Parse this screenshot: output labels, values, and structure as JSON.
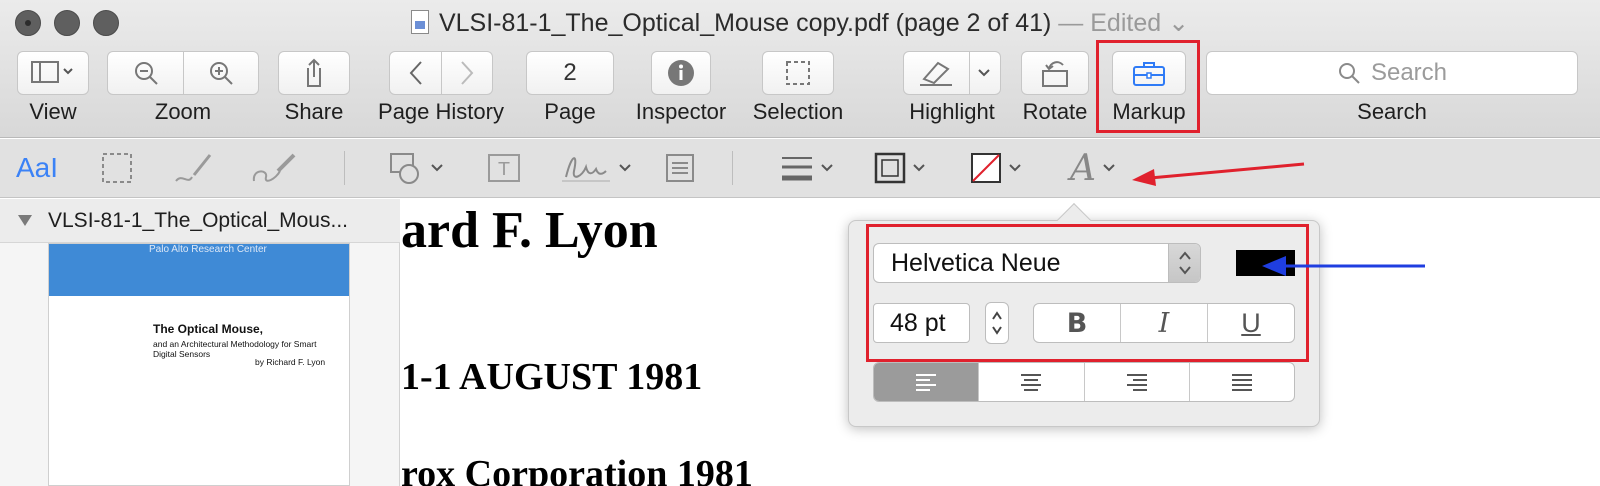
{
  "window": {
    "title": "VLSI-81-1_The_Optical_Mouse copy.pdf (page 2 of 41)",
    "edited": "— Edited"
  },
  "toolbar": {
    "view_label": "View",
    "zoom_label": "Zoom",
    "share_label": "Share",
    "page_history_label": "Page History",
    "page_value": "2",
    "page_label": "Page",
    "inspector_label": "Inspector",
    "selection_label": "Selection",
    "highlight_label": "Highlight",
    "rotate_label": "Rotate",
    "markup_label": "Markup",
    "search_placeholder": "Search",
    "search_label": "Search"
  },
  "markup_bar": {
    "text_tool": "AaI"
  },
  "sidebar": {
    "doc_name": "VLSI-81-1_The_Optical_Mous...",
    "thumb": {
      "header": "Palo Alto Research Center",
      "title": "The Optical Mouse,",
      "subtitle": "and an Architectural Methodology for Smart Digital Sensors",
      "author": "by Richard F. Lyon"
    }
  },
  "document": {
    "line1": "ard F. Lyon",
    "line2": "1-1   AUGUST 1981",
    "line3": "rox  Corporation  1981"
  },
  "font_popover": {
    "font_name": "Helvetica Neue",
    "font_size": "48 pt",
    "bold": "B",
    "italic": "I",
    "underline": "U",
    "text_color": "#000000",
    "selected_alignment": "left"
  },
  "annotations": {
    "red": "#e0212d",
    "blue": "#1f3ee0"
  }
}
